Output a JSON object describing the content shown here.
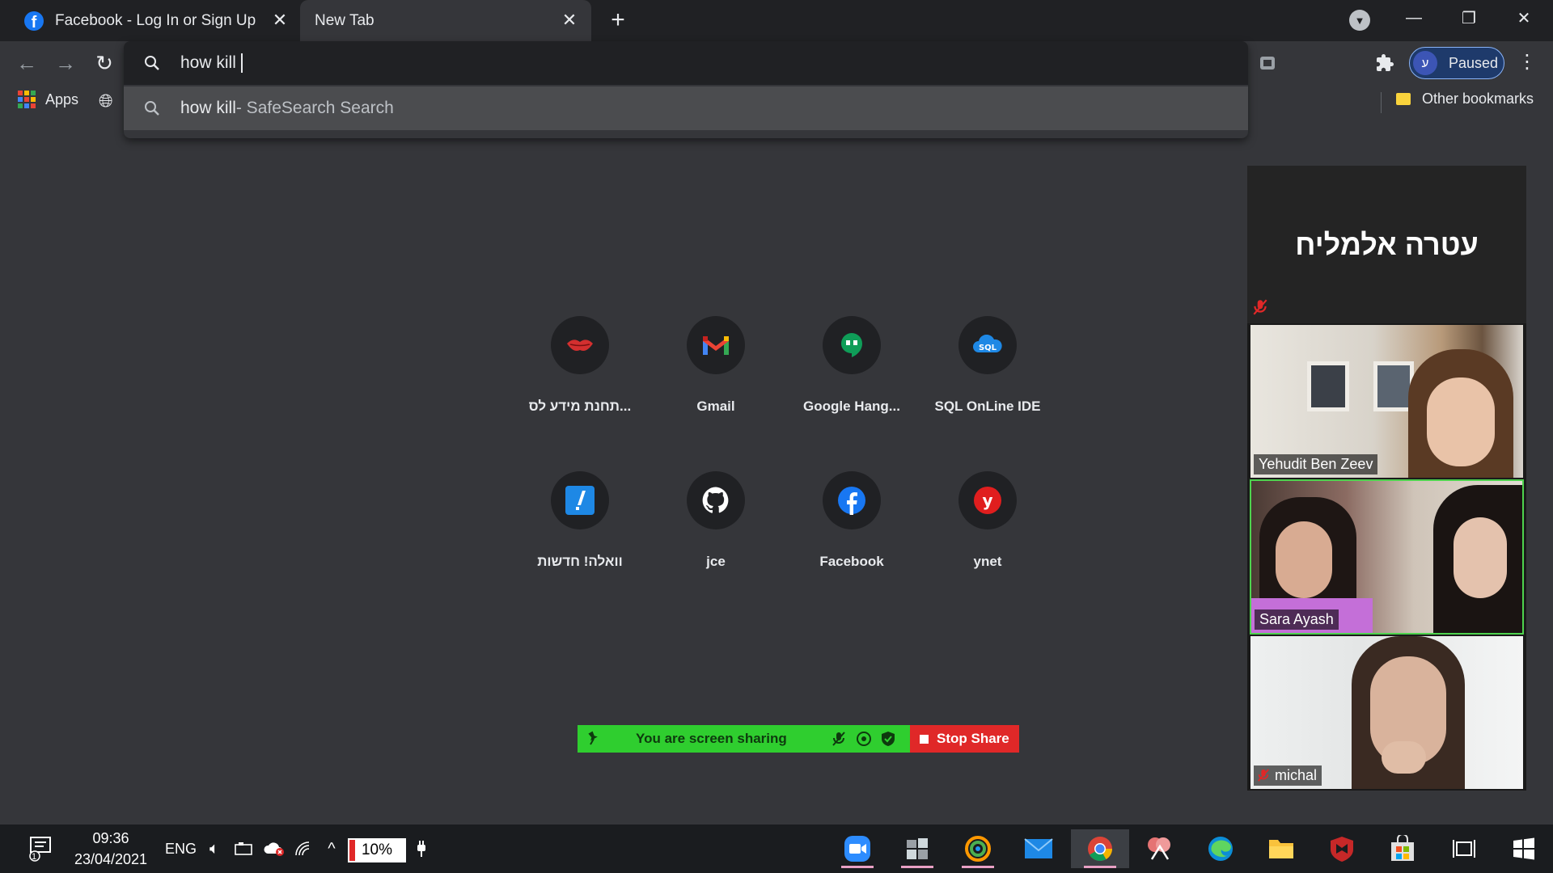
{
  "tabs": [
    {
      "title": "Facebook - Log In or Sign Up",
      "favicon": "facebook-icon"
    },
    {
      "title": "New Tab",
      "active": true
    }
  ],
  "window_controls": [
    "minimize",
    "restore",
    "close"
  ],
  "omnibox": {
    "value": "how kill",
    "suggestion_query": "how kill",
    "suggestion_suffix": " - SafeSearch Search"
  },
  "profile": {
    "initial": "ע",
    "status": "Paused"
  },
  "bookmarks": {
    "apps": "Apps",
    "other": "Other bookmarks"
  },
  "shortcuts": [
    {
      "label": "תחנת מידע לס...",
      "icon": "lips-icon"
    },
    {
      "label": "Gmail",
      "icon": "gmail-icon"
    },
    {
      "label": "Google Hang...",
      "icon": "hangouts-icon"
    },
    {
      "label": "SQL OnLine IDE",
      "icon": "sql-icon"
    },
    {
      "label": "וואלה! חדשות",
      "icon": "walla-icon"
    },
    {
      "label": "jce",
      "icon": "github-icon"
    },
    {
      "label": "Facebook",
      "icon": "facebook-icon"
    },
    {
      "label": "ynet",
      "icon": "ynet-icon"
    }
  ],
  "screen_share": {
    "status": "You are screen sharing",
    "stop": "Stop Share"
  },
  "participants": [
    {
      "name": "עטרה אלמליח",
      "video": false,
      "muted": true
    },
    {
      "name": "Yehudit Ben Zeev",
      "video": true
    },
    {
      "name": "Sara Ayash",
      "video": true,
      "speaking": true
    },
    {
      "name": "michal",
      "video": true,
      "muted": true
    }
  ],
  "taskbar": {
    "notification_count": "1",
    "time": "09:36",
    "date": "23/04/2021",
    "language": "ENG",
    "battery": "10%"
  },
  "colors": {
    "accent": "#8ab4f8",
    "share_green": "#2fce2f",
    "stop_red": "#e02828"
  }
}
